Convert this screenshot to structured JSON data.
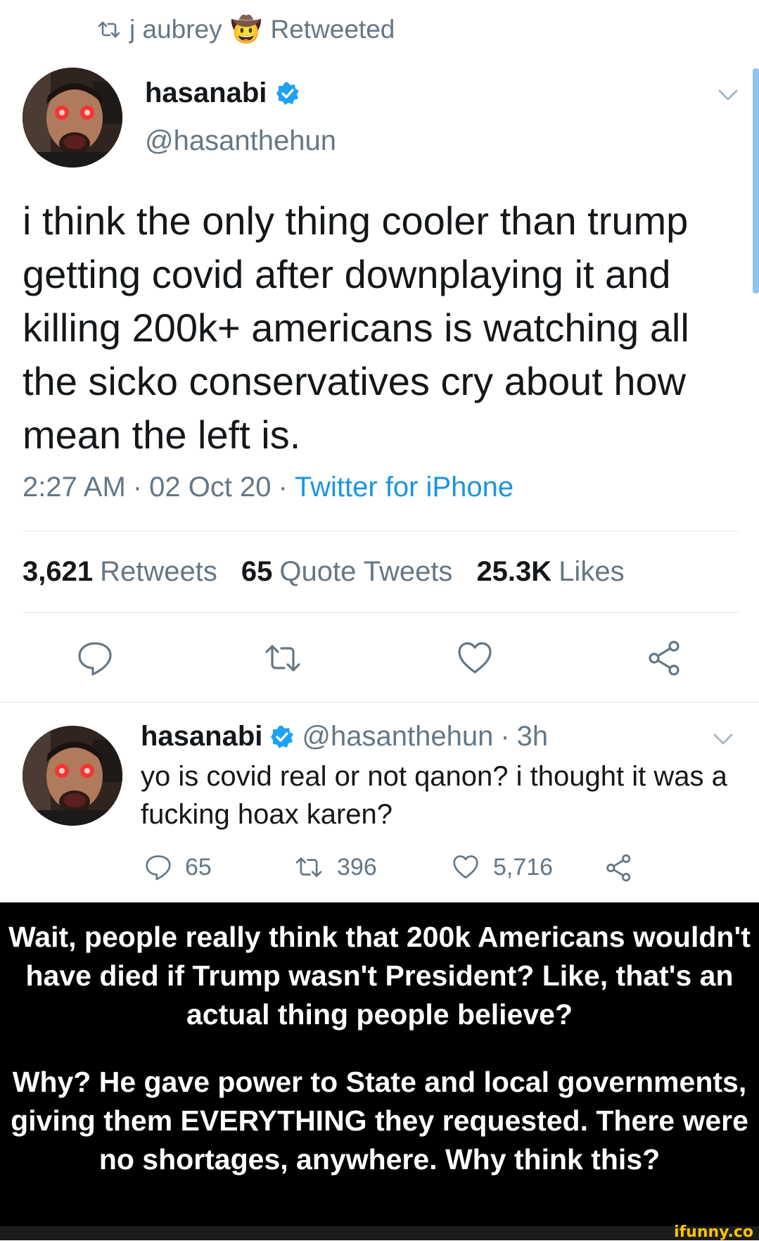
{
  "retweet_banner": {
    "user": "j aubrey",
    "emoji": "🤠",
    "label": "Retweeted"
  },
  "main_tweet": {
    "display_name": "hasanabi",
    "handle": "@hasanthehun",
    "text": "i think the only thing cooler than trump getting covid after downplaying it and killing 200k+ americans is watching all the sicko conservatives cry about how mean the left is.",
    "time": "2:27 AM",
    "date": "02 Oct 20",
    "separator": "·",
    "source": "Twitter for iPhone",
    "stats": {
      "retweets_num": "3,621",
      "retweets_label": "Retweets",
      "quotes_num": "65",
      "quotes_label": "Quote Tweets",
      "likes_num": "25.3K",
      "likes_label": "Likes"
    }
  },
  "reply_tweet": {
    "display_name": "hasanabi",
    "handle": "@hasanthehun",
    "separator": "·",
    "time": "3h",
    "text": "yo is covid real or not qanon? i thought it was a fucking hoax karen?",
    "reply_count": "65",
    "retweet_count": "396",
    "like_count": "5,716"
  },
  "caption": {
    "paragraph1": "Wait, people really think that 200k Americans wouldn't have died if Trump wasn't President? Like, that's an actual thing people believe?",
    "paragraph2": "Why? He gave power to State and local governments, giving them EVERYTHING they requested. There were no shortages, anywhere. Why think this?"
  },
  "watermark": "ifunny.co",
  "colors": {
    "text_primary": "#14171a",
    "text_secondary": "#657786",
    "link_blue": "#1b95e0",
    "verified_blue": "#1da1f2",
    "caption_bg": "#000000",
    "caption_text": "#ffffff",
    "watermark_yellow": "#f7c400"
  },
  "icons": [
    "retweet-icon",
    "cowboy-emoji",
    "verified-badge-icon",
    "chevron-down-icon",
    "reply-icon",
    "retweet-icon",
    "heart-icon",
    "share-icon"
  ]
}
